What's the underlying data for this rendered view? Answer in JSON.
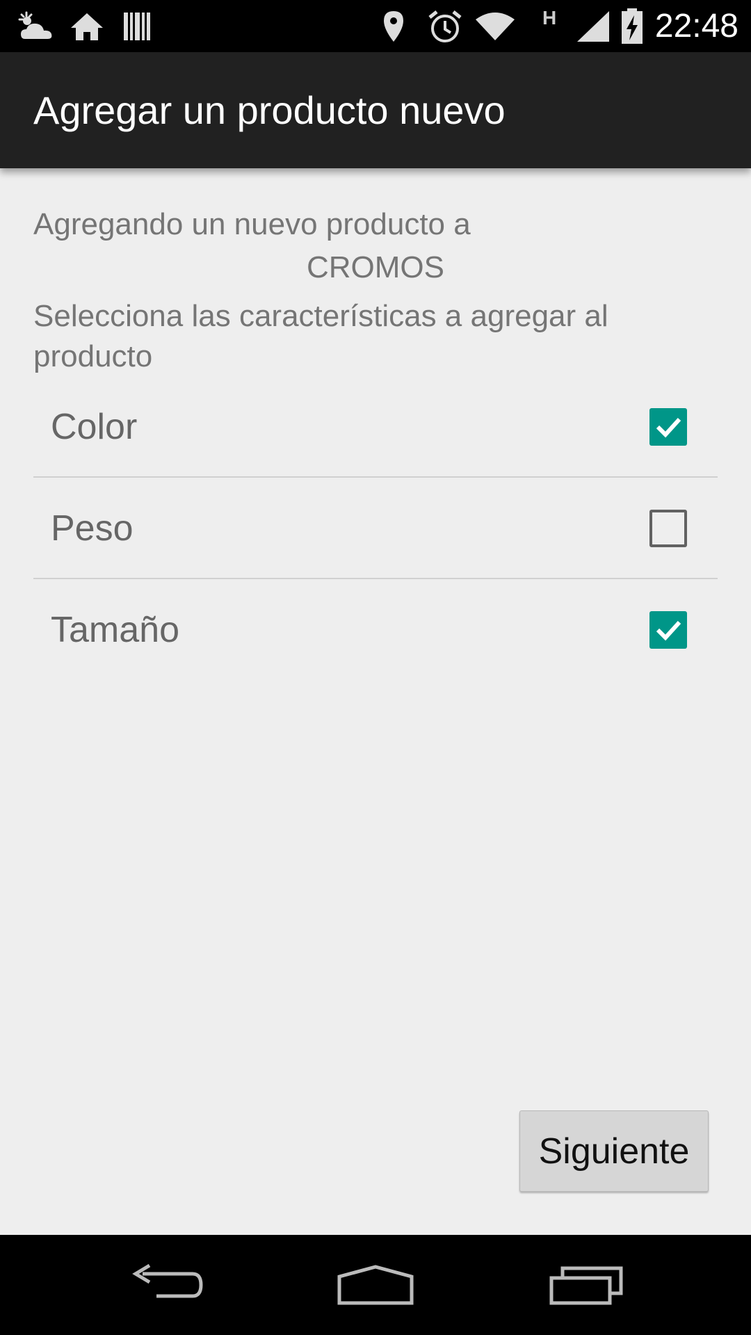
{
  "status_bar": {
    "time": "22:48",
    "network_type": "H",
    "icons": [
      "weather-cloudy-icon",
      "home-icon",
      "barcode-icon",
      "location-icon",
      "alarm-icon",
      "wifi-icon",
      "signal-icon",
      "battery-charging-icon"
    ]
  },
  "action_bar": {
    "title": "Agregar un producto nuevo"
  },
  "content": {
    "intro": "Agregando un nuevo producto a",
    "store_name": "CROMOS",
    "instructions": "Selecciona las características a agregar al producto"
  },
  "options": [
    {
      "label": "Color",
      "checked": true
    },
    {
      "label": "Peso",
      "checked": false
    },
    {
      "label": "Tamaño",
      "checked": true
    }
  ],
  "button": {
    "label": "Siguiente"
  },
  "nav_bar": {
    "icons": [
      "back-icon",
      "home-nav-icon",
      "recents-icon"
    ]
  },
  "colors": {
    "accent": "#009688",
    "action_bar": "#212121",
    "background": "#eeeeee"
  }
}
